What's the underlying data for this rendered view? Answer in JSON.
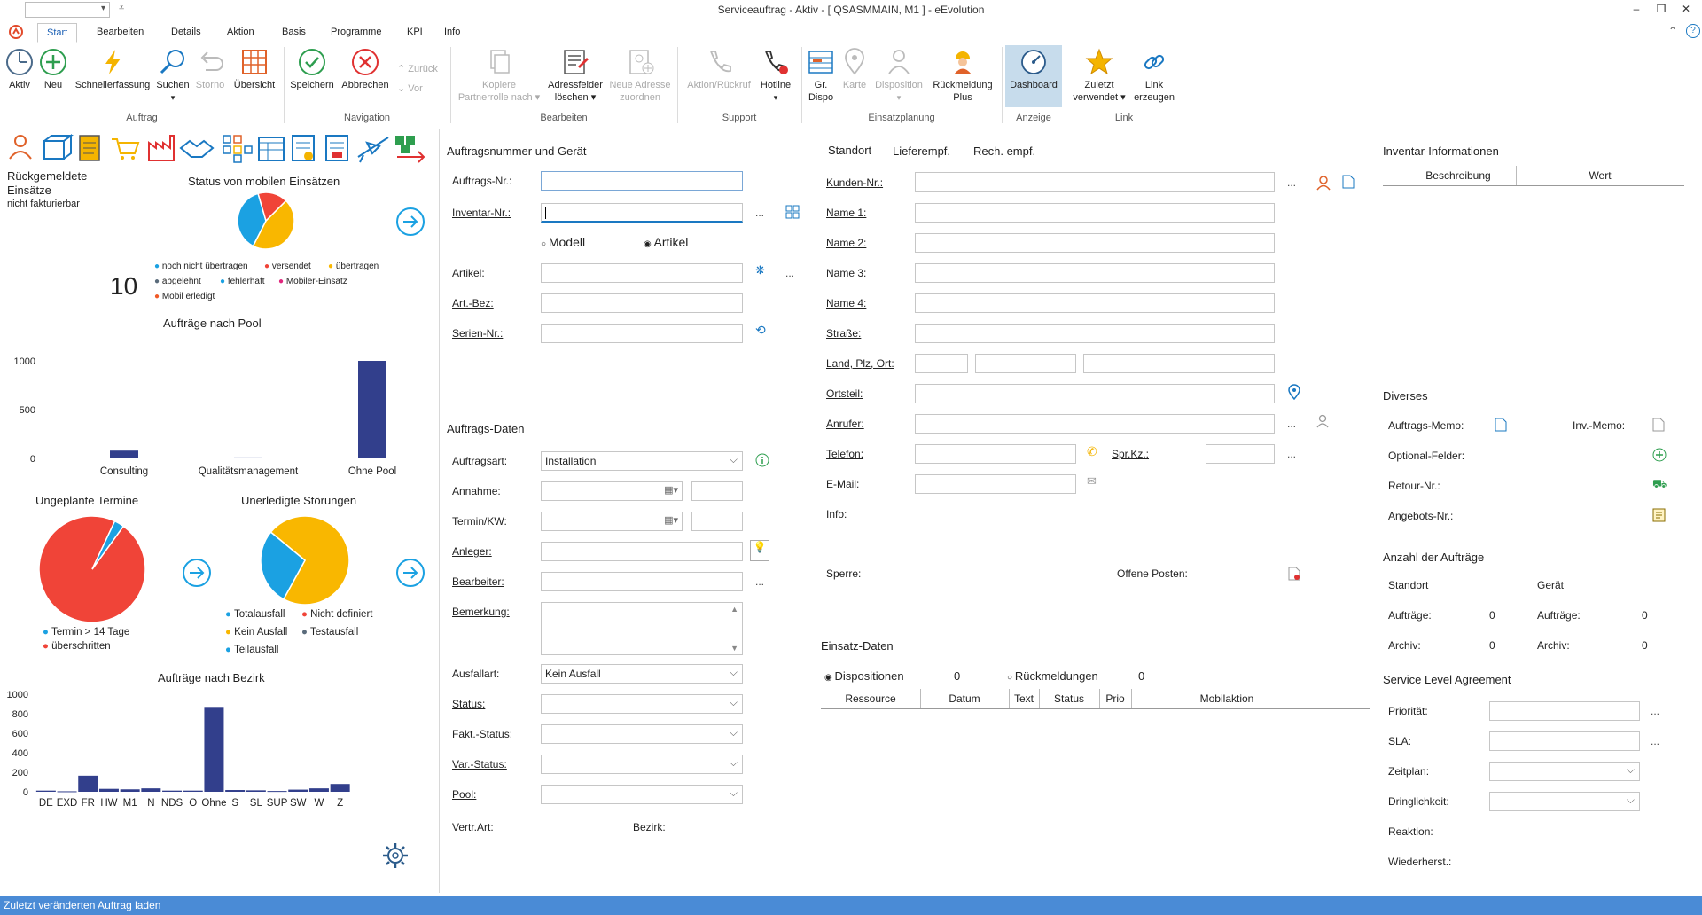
{
  "window": {
    "title": "Serviceauftrag - Aktiv - [ QSASMMAIN, M1 ] - eEvolution",
    "quick_value": ""
  },
  "tabs": [
    "Start",
    "Bearbeiten",
    "Details",
    "Aktion",
    "Basis",
    "Programme",
    "KPI",
    "Info"
  ],
  "ribbon": {
    "auftrag": {
      "aktiv": "Aktiv",
      "neu": "Neu",
      "schnell": "Schnellerfassung",
      "suchen": "Suchen",
      "storno": "Storno",
      "uebersicht": "Übersicht",
      "group": "Auftrag"
    },
    "navigation": {
      "speichern": "Speichern",
      "abbrechen": "Abbrechen",
      "zurueck": "Zurück",
      "vor": "Vor",
      "group": "Navigation"
    },
    "bearbeiten": {
      "kopiere_1": "Kopiere",
      "kopiere_2": "Partnerrolle nach",
      "adress_1": "Adressfelder",
      "adress_2": "löschen",
      "neue_1": "Neue Adresse",
      "neue_2": "zuordnen",
      "group": "Bearbeiten"
    },
    "support": {
      "aktion": "Aktion/Rückruf",
      "hotline": "Hotline",
      "group": "Support"
    },
    "einsatz": {
      "gr_1": "Gr.",
      "gr_2": "Dispo",
      "karte": "Karte",
      "dispo": "Disposition",
      "rueck_1": "Rückmeldung",
      "rueck_2": "Plus",
      "group": "Einsatzplanung"
    },
    "anzeige": {
      "dashboard": "Dashboard",
      "group": "Anzeige"
    },
    "link": {
      "zuletzt_1": "Zuletzt",
      "zuletzt_2": "verwendet",
      "link_1": "Link",
      "link_2": "erzeugen",
      "group": "Link"
    }
  },
  "dashboard": {
    "rueck_title_1": "Rückgemeldete",
    "rueck_title_2": "Einsätze",
    "rueck_sub": "nicht fakturierbar",
    "rueck_value": "10",
    "status_title": "Status von mobilen Einsätzen",
    "status_legend": [
      {
        "label": "noch nicht übertragen",
        "color": "#1ba1e2"
      },
      {
        "label": "versendet",
        "color": "#f04438"
      },
      {
        "label": "übertragen",
        "color": "#f9b700"
      },
      {
        "label": "abgelehnt",
        "color": "#5a6b7b"
      },
      {
        "label": "fehlerhaft",
        "color": "#1ba1e2"
      },
      {
        "label": "Mobiler-Einsatz",
        "color": "#e0267d"
      },
      {
        "label": "Mobil erledigt",
        "color": "#f05a28"
      }
    ],
    "pool_title": "Aufträge nach Pool",
    "ungeplant_title": "Ungeplante Termine",
    "ungeplant_legend": [
      {
        "label": "Termin > 14 Tage",
        "color": "#1ba1e2"
      },
      {
        "label": "überschritten",
        "color": "#f04438"
      }
    ],
    "stoer_title": "Unerledigte Störungen",
    "stoer_legend": [
      {
        "label": "Totalausfall",
        "color": "#1ba1e2"
      },
      {
        "label": "Nicht definiert",
        "color": "#f04438"
      },
      {
        "label": "Kein Ausfall",
        "color": "#f9b700"
      },
      {
        "label": "Testausfall",
        "color": "#5a6b7b"
      },
      {
        "label": "Teilausfall",
        "color": "#1ba1e2"
      }
    ],
    "bezirk_title": "Aufträge nach Bezirk"
  },
  "chart_data": [
    {
      "type": "pie",
      "title": "Status von mobilen Einsätzen",
      "slices": [
        {
          "label": "übertragen",
          "value": 45,
          "color": "#f9b700"
        },
        {
          "label": "noch nicht übertragen",
          "value": 38,
          "color": "#1ba1e2"
        },
        {
          "label": "versendet",
          "value": 17,
          "color": "#f04438"
        }
      ]
    },
    {
      "type": "bar",
      "title": "Aufträge nach Pool",
      "categories": [
        "Consulting",
        "Qualitätsmanagement",
        "Ohne Pool"
      ],
      "values": [
        80,
        10,
        1000
      ],
      "ylim": [
        0,
        1000
      ],
      "yticks": [
        "1000",
        "500",
        "0"
      ],
      "color": "#323f8c"
    },
    {
      "type": "pie",
      "title": "Ungeplante Termine",
      "slices": [
        {
          "label": "überschritten",
          "value": 97,
          "color": "#f04438"
        },
        {
          "label": "Termin > 14 Tage",
          "value": 3,
          "color": "#1ba1e2"
        }
      ]
    },
    {
      "type": "pie",
      "title": "Unerledigte Störungen",
      "slices": [
        {
          "label": "Kein Ausfall",
          "value": 72,
          "color": "#f9b700"
        },
        {
          "label": "Totalausfall",
          "value": 28,
          "color": "#1ba1e2"
        }
      ]
    },
    {
      "type": "bar",
      "title": "Aufträge nach Bezirk",
      "categories": [
        "DE",
        "EXD",
        "FR",
        "HW",
        "M1",
        "N",
        "NDS",
        "O",
        "Ohne",
        "S",
        "SL",
        "SUP",
        "SW",
        "W",
        "Z"
      ],
      "values": [
        12,
        5,
        165,
        30,
        25,
        35,
        12,
        12,
        870,
        18,
        15,
        8,
        22,
        35,
        80
      ],
      "ylim": [
        0,
        1000
      ],
      "yticks": [
        "1000",
        "800",
        "600",
        "400",
        "200",
        "0"
      ],
      "color": "#323f8c"
    }
  ],
  "auftrag": {
    "header": "Auftragsnummer und Gerät",
    "auftragsnr": "Auftrags-Nr.:",
    "inventarnr": "Inventar-Nr.:",
    "modell": "Modell",
    "artikel_radio": "Artikel",
    "artikel": "Artikel:",
    "artbez": "Art.-Bez:",
    "seriennr": "Serien-Nr.:",
    "daten_header": "Auftrags-Daten",
    "auftragsart": "Auftragsart:",
    "auftragsart_value": "Installation",
    "annahme": "Annahme:",
    "termin": "Termin/KW:",
    "anleger": "Anleger:",
    "bearbeiter": "Bearbeiter:",
    "bemerkung": "Bemerkung:",
    "ausfallart": "Ausfallart:",
    "ausfallart_value": "Kein Ausfall",
    "status": "Status:",
    "fakt": "Fakt.-Status:",
    "var": "Var.-Status:",
    "pool": "Pool:",
    "vertr": "Vertr.Art:",
    "bezirk": "Bezirk:"
  },
  "kunde": {
    "tabs": [
      "Standort",
      "Lieferempf.",
      "Rech. empf."
    ],
    "kundennr": "Kunden-Nr.:",
    "name1": "Name 1:",
    "name2": "Name 2:",
    "name3": "Name 3:",
    "name4": "Name 4:",
    "strasse": "Straße:",
    "land": "Land, Plz, Ort:",
    "ortsteil": "Ortsteil:",
    "anrufer": "Anrufer:",
    "telefon": "Telefon:",
    "sprkz": "Spr.Kz.:",
    "email": "E-Mail:",
    "info": "Info:",
    "sperre": "Sperre:",
    "offene": "Offene Posten:"
  },
  "einsatz": {
    "header": "Einsatz-Daten",
    "dispo": "Dispositionen",
    "dispo_count": "0",
    "rueck": "Rückmeldungen",
    "rueck_count": "0",
    "columns": [
      "Ressource",
      "Datum",
      "Text",
      "Status",
      "Prio",
      "Mobilaktion"
    ]
  },
  "inventar": {
    "header": "Inventar-Informationen",
    "columns": [
      "Beschreibung",
      "Wert"
    ]
  },
  "diverses": {
    "header": "Diverses",
    "auftragsmemo": "Auftrags-Memo:",
    "invmemo": "Inv.-Memo:",
    "optional": "Optional-Felder:",
    "retour": "Retour-Nr.:",
    "angebots": "Angebots-Nr.:"
  },
  "anzahl": {
    "header": "Anzahl der Aufträge",
    "standort": "Standort",
    "geraet": "Gerät",
    "auftraege": "Aufträge:",
    "archiv": "Archiv:",
    "s_auftraege": "0",
    "s_archiv": "0",
    "g_auftraege": "0",
    "g_archiv": "0"
  },
  "sla": {
    "header": "Service Level Agreement",
    "prioritaet": "Priorität:",
    "sla": "SLA:",
    "zeitplan": "Zeitplan:",
    "dringlichkeit": "Dringlichkeit:",
    "reaktion": "Reaktion:",
    "wiederherst": "Wiederherst.:"
  },
  "statusbar": {
    "text": "Zuletzt veränderten Auftrag laden"
  }
}
